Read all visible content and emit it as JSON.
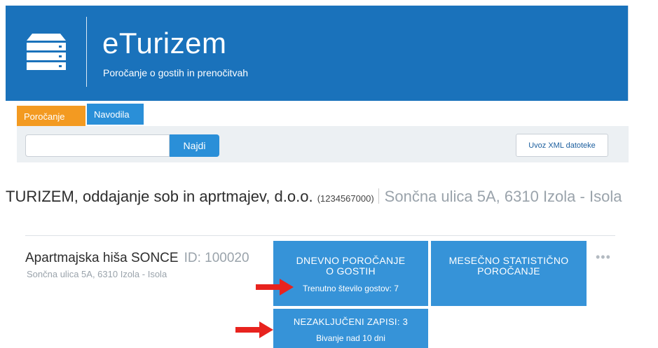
{
  "header": {
    "app_title": "eTurizem",
    "app_subtitle": "Poročanje o gostih in prenočitvah",
    "logo_icon": "server-icon",
    "background_color": "#1a72bb"
  },
  "tabs": [
    {
      "label": "Poročanje",
      "active": true,
      "color": "#f39a21"
    },
    {
      "label": "Navodila",
      "active": false,
      "color": "#2a8fd8"
    }
  ],
  "search": {
    "value": "",
    "placeholder": "",
    "button_label": "Najdi"
  },
  "toolbar": {
    "xml_import_label": "Uvoz XML datoteke"
  },
  "company": {
    "name": "TURIZEM, oddajanje sob in aprtmajev, d.o.o.",
    "tax_id": "(1234567000)",
    "address": "Sončna ulica 5A, 6310 Izola - Isola"
  },
  "unit": {
    "name": "Apartmajska hiša SONCE",
    "id_label": "ID: 100020",
    "address": "Sončna ulica 5A, 6310 Izola - Isola"
  },
  "tiles": {
    "daily": {
      "title_line1": "DNEVNO POROČANJE",
      "title_line2": "O GOSTIH",
      "subtitle": "Trenutno število gostov: 7"
    },
    "monthly": {
      "title_line1": "MESEČNO STATISTIČNO",
      "title_line2": "POROČANJE"
    },
    "open": {
      "title": "NEZAKLJUČENI ZAPISI: 3",
      "subtitle": "Bivanje nad 10 dni"
    }
  },
  "more_icon": "more-horizontal-icon",
  "annotation_arrow_color": "#e8231e",
  "accent_color": "#3693d8"
}
